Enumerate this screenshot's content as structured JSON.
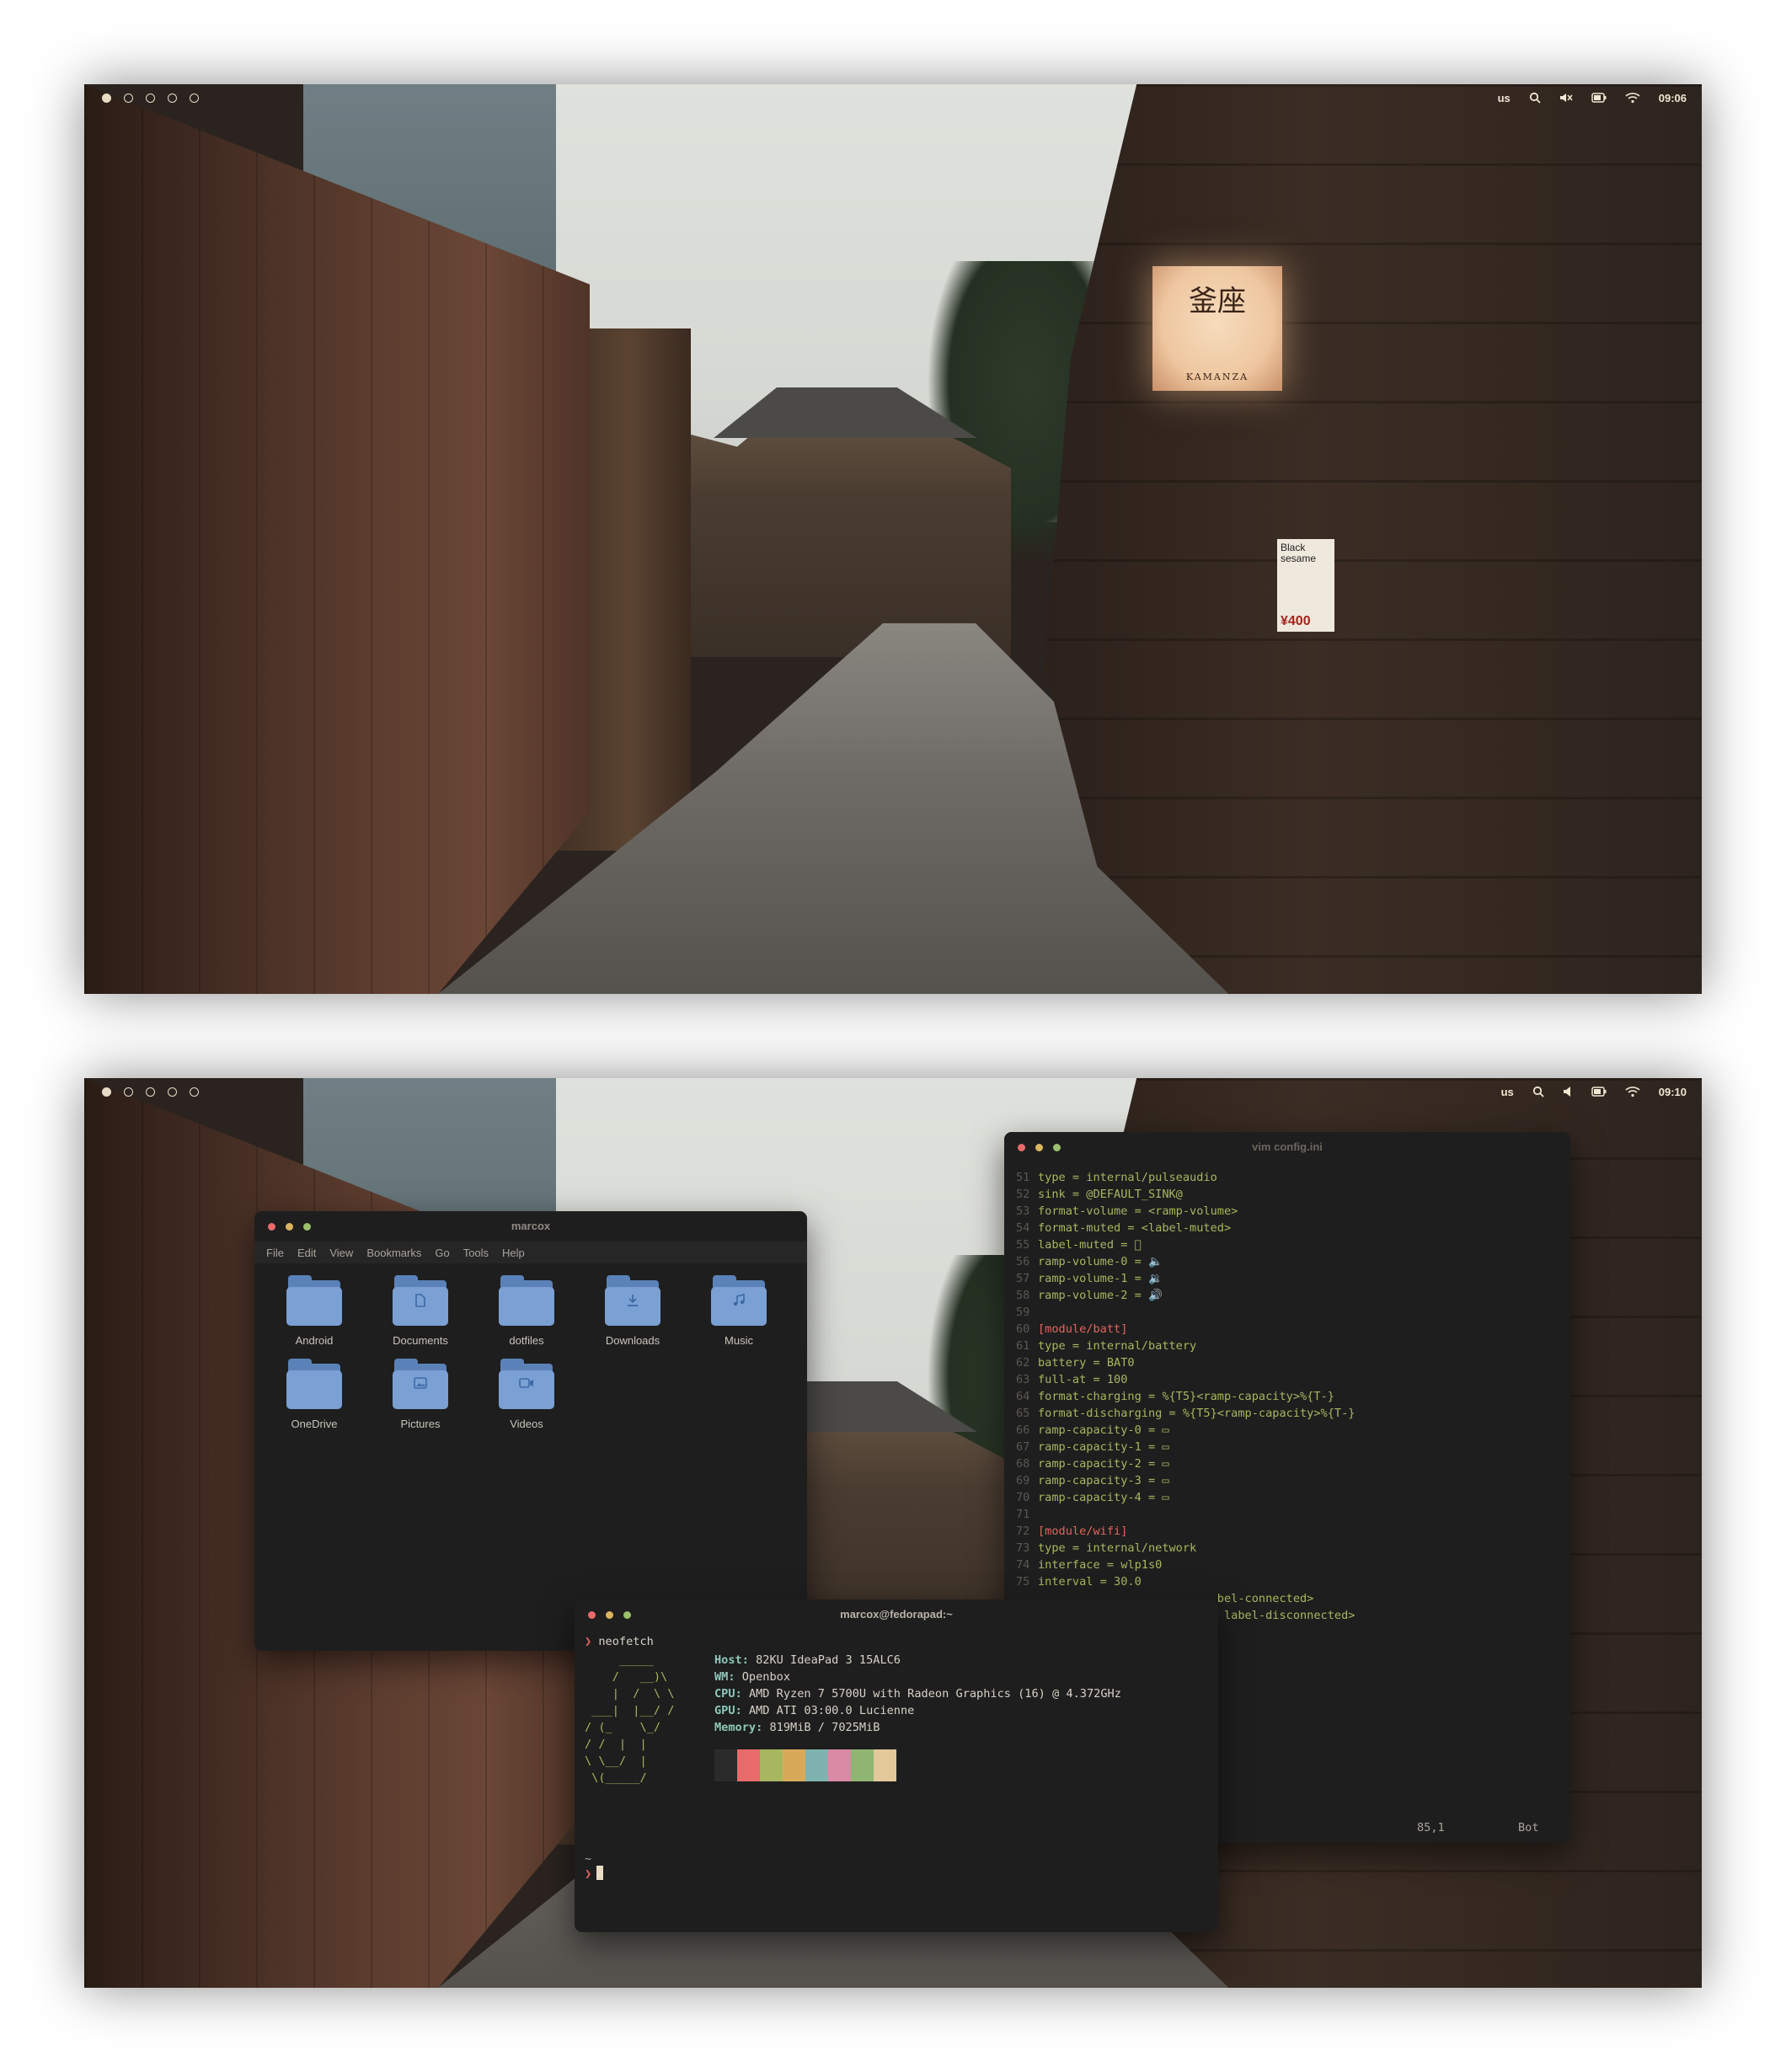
{
  "screens": [
    {
      "workspaces": [
        true,
        false,
        false,
        false,
        false
      ],
      "tray": {
        "keyboard_layout": "us",
        "clock": "09:06",
        "volume_muted": true
      }
    },
    {
      "workspaces": [
        true,
        false,
        false,
        false,
        false
      ],
      "tray": {
        "keyboard_layout": "us",
        "clock": "09:10",
        "volume_muted": false
      }
    }
  ],
  "wallpaper": {
    "lantern_kanji": "釜座",
    "lantern_latin": "KAMANZA",
    "poster_text": "Black sesame",
    "poster_price": "¥400"
  },
  "file_manager": {
    "title": "marcox",
    "menu": [
      "File",
      "Edit",
      "View",
      "Bookmarks",
      "Go",
      "Tools",
      "Help"
    ],
    "items": [
      {
        "label": "Android",
        "icon": "folder-icon"
      },
      {
        "label": "Documents",
        "icon": "document-folder-icon"
      },
      {
        "label": "dotfiles",
        "icon": "folder-icon"
      },
      {
        "label": "Downloads",
        "icon": "download-folder-icon"
      },
      {
        "label": "Music",
        "icon": "music-folder-icon"
      },
      {
        "label": "OneDrive",
        "icon": "folder-icon"
      },
      {
        "label": "Pictures",
        "icon": "picture-folder-icon"
      },
      {
        "label": "Videos",
        "icon": "video-folder-icon"
      }
    ]
  },
  "vim": {
    "title": "vim config.ini",
    "lines": [
      {
        "n": "51",
        "t": "type = internal/pulseaudio"
      },
      {
        "n": "52",
        "t": "sink = @DEFAULT_SINK@"
      },
      {
        "n": "53",
        "t": "format-volume = <ramp-volume>"
      },
      {
        "n": "54",
        "t": "format-muted = <label-muted>"
      },
      {
        "n": "55",
        "t": "label-muted = 󰖁"
      },
      {
        "n": "56",
        "t": "ramp-volume-0 = 🔈"
      },
      {
        "n": "57",
        "t": "ramp-volume-1 = 🔉"
      },
      {
        "n": "58",
        "t": "ramp-volume-2 = 🔊"
      },
      {
        "n": "59",
        "t": ""
      },
      {
        "n": "60",
        "t": "[module/batt]",
        "section": true
      },
      {
        "n": "61",
        "t": "type = internal/battery"
      },
      {
        "n": "62",
        "t": "battery = BAT0"
      },
      {
        "n": "63",
        "t": "full-at = 100"
      },
      {
        "n": "64",
        "t": "format-charging = %{T5}<ramp-capacity>%{T-}"
      },
      {
        "n": "65",
        "t": "format-discharging = %{T5}<ramp-capacity>%{T-}"
      },
      {
        "n": "66",
        "t": "ramp-capacity-0 = ▭"
      },
      {
        "n": "67",
        "t": "ramp-capacity-1 = ▭"
      },
      {
        "n": "68",
        "t": "ramp-capacity-2 = ▭"
      },
      {
        "n": "69",
        "t": "ramp-capacity-3 = ▭"
      },
      {
        "n": "70",
        "t": "ramp-capacity-4 = ▭"
      },
      {
        "n": "71",
        "t": ""
      },
      {
        "n": "72",
        "t": "[module/wifi]",
        "section": true
      },
      {
        "n": "73",
        "t": "type = internal/network"
      },
      {
        "n": "74",
        "t": "interface = wlp1s0"
      },
      {
        "n": "75",
        "t": "interval = 30.0"
      },
      {
        "n": "",
        "t": "                          bel-connected>"
      },
      {
        "n": "",
        "t": "                           label-disconnected>"
      }
    ],
    "status_position": "85,1",
    "status_scroll": "Bot"
  },
  "terminal": {
    "title": "marcox@fedorapad:~",
    "command": "neofetch",
    "ascii_logo": "     _____\n    /   __)\\\n    |  /  \\ \\\n ___|  |__/ /\n/ (_    \\_/\n/ /  |  |\n\\ \\__/  |\n \\(_____/",
    "info": [
      {
        "key": "Host",
        "value": "82KU IdeaPad 3 15ALC6"
      },
      {
        "key": "WM",
        "value": "Openbox"
      },
      {
        "key": "CPU",
        "value": "AMD Ryzen 7 5700U with Radeon Graphics (16) @ 4.372GHz"
      },
      {
        "key": "GPU",
        "value": "AMD ATI 03:00.0 Lucienne"
      },
      {
        "key": "Memory",
        "value": "819MiB / 7025MiB"
      }
    ],
    "palette": [
      "#2b2b2b",
      "#e86a6a",
      "#a8b660",
      "#d9a95a",
      "#7fb3b0",
      "#d98aa4",
      "#8fb573",
      "#e3c89a"
    ],
    "tilde": "~"
  },
  "colors": {
    "accent": "#e8dcc4",
    "folder": "#7aa0d4",
    "code_green": "#a8b660",
    "section_red": "#e0665e",
    "info_cyan": "#8ec7b8"
  }
}
